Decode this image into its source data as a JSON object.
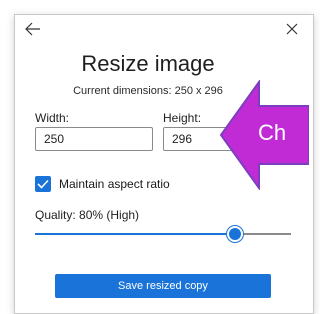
{
  "dialog": {
    "title": "Resize image",
    "current_dimensions": "Current dimensions: 250 x 296",
    "width_label": "Width:",
    "height_label": "Height:",
    "width_value": "250",
    "height_value": "296",
    "maintain_aspect_label": "Maintain aspect ratio",
    "maintain_aspect_checked": true,
    "quality_label": "Quality: 80% (High)",
    "quality_fraction": 0.8,
    "save_label": "Save resized copy"
  },
  "callout": {
    "text": "Ch",
    "fill": "#c02bd6",
    "stroke": "#7a3fbf"
  },
  "icons": {
    "back": "back-arrow-icon",
    "close": "close-icon",
    "check": "checkmark-icon"
  },
  "colors": {
    "accent": "#1a73d8",
    "track_rest": "#8a8a8a"
  }
}
